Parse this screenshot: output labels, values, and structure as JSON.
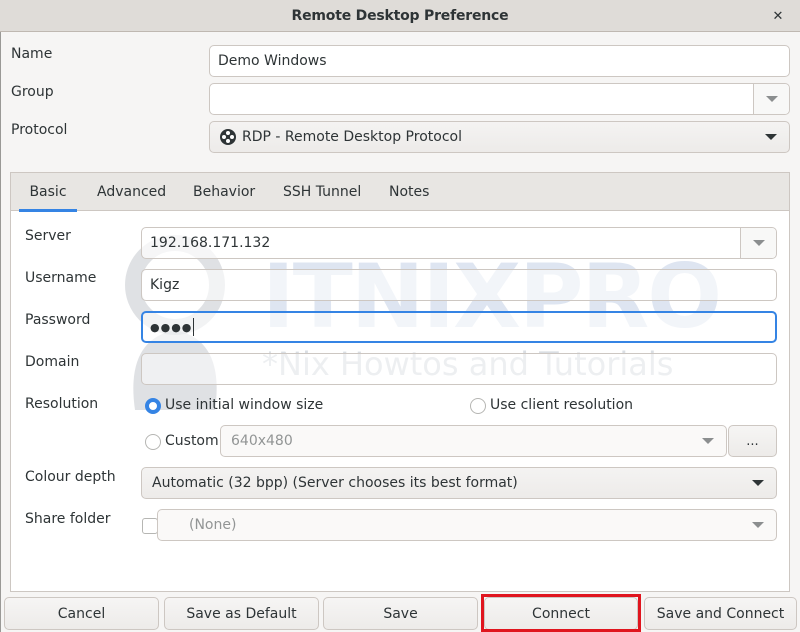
{
  "window": {
    "title": "Remote Desktop Preference",
    "close_icon": "close-icon"
  },
  "profile": {
    "name_label": "Name",
    "name_value": "Demo Windows",
    "group_label": "Group",
    "group_value": "",
    "protocol_label": "Protocol",
    "protocol_value": "RDP - Remote Desktop Protocol",
    "protocol_icon": "rdp-plugin-icon"
  },
  "tabs": [
    {
      "label": "Basic",
      "active": true
    },
    {
      "label": "Advanced",
      "active": false
    },
    {
      "label": "Behavior",
      "active": false
    },
    {
      "label": "SSH Tunnel",
      "active": false
    },
    {
      "label": "Notes",
      "active": false
    }
  ],
  "basic": {
    "server_label": "Server",
    "server_value": "192.168.171.132",
    "username_label": "Username",
    "username_value": "Kigz",
    "password_label": "Password",
    "password_value": "●●●●",
    "domain_label": "Domain",
    "domain_value": "",
    "resolution_label": "Resolution",
    "resolution_options": [
      {
        "label": "Use initial window size",
        "checked": true
      },
      {
        "label": "Use client resolution",
        "checked": false
      },
      {
        "label": "Custom",
        "checked": false
      }
    ],
    "custom_resolution_value": "640x480",
    "custom_resolution_more": "...",
    "colour_depth_label": "Colour depth",
    "colour_depth_value": "Automatic (32 bpp) (Server chooses its best format)",
    "share_folder_label": "Share folder",
    "share_folder_checked": false,
    "share_folder_value": "(None)"
  },
  "watermark": {
    "logo": "ITNIXPRO",
    "tagline": "*Nix Howtos and Tutorials"
  },
  "buttons": {
    "cancel": "Cancel",
    "save_default": "Save as Default",
    "save": "Save",
    "connect": "Connect",
    "save_connect": "Save and Connect"
  },
  "colors": {
    "accent": "#3584e4",
    "highlight": "#e0151e"
  }
}
